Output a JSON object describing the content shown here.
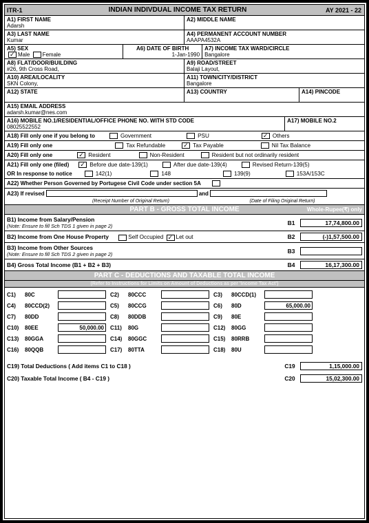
{
  "header": {
    "code": "ITR-1",
    "title": "INDIAN INDIVDUAL INCOME TAX RETURN",
    "ay": "AY 2021 - 22"
  },
  "a1": {
    "lbl": "A1) FIRST NAME",
    "val": "Adarsh"
  },
  "a2": {
    "lbl": "A2) MIDDLE NAME",
    "val": ""
  },
  "a3": {
    "lbl": "A3) LAST NAME",
    "val": "Kumar"
  },
  "a4": {
    "lbl": "A4) PERMANENT ACCOUNT NUMBER",
    "val": "AAAPA4532A"
  },
  "a5": {
    "lbl": "A5) SEX",
    "male": "Male",
    "female": "Female"
  },
  "a6": {
    "lbl": "A6) DATE OF BIRTH",
    "val": "1-Jan-1990"
  },
  "a7": {
    "lbl": "A7) INCOME TAX WARD/CIRCLE",
    "val": "Bangalore"
  },
  "a8": {
    "lbl": "A8) FLAT/DOOR/BUILDING",
    "val": "#26, 9th Cross Road,"
  },
  "a9": {
    "lbl": "A9) ROAD/STREET",
    "val": "Balaji Layout,"
  },
  "a10": {
    "lbl": "A10) AREA/LOCALITY",
    "val": "SKN Colony,"
  },
  "a11": {
    "lbl": "A11) TOWN/CITY/DISTRICT",
    "val": "Bangalore"
  },
  "a12": {
    "lbl": "A12) STATE"
  },
  "a13": {
    "lbl": "A13) COUNTRY"
  },
  "a14": {
    "lbl": "A14) PINCODE"
  },
  "a15": {
    "lbl": "A15) EMAIL ADDRESS",
    "val": "adarsh.kumar@nes.com"
  },
  "a16": {
    "lbl": "A16) MOBILE NO.1/RESIDENTIAL/OFFICE PHONE NO. WITH STD CODE",
    "val": "08025522552"
  },
  "a17": {
    "lbl": "A17) MOBILE NO.2"
  },
  "a18": {
    "lbl": "A18) Fill only one if you belong to",
    "o1": "Government",
    "o2": "PSU",
    "o3": "Others"
  },
  "a19": {
    "lbl": "A19) Fill only one",
    "o1": "Tax Refundable",
    "o2": "Tax Payable",
    "o3": "Nil Tax Balance"
  },
  "a20": {
    "lbl": "A20) Fill only one",
    "o1": "Resident",
    "o2": "Non-Resident",
    "o3": "Resident but not ordinarily resident"
  },
  "a21": {
    "lbl": "A21) Fill only one (filed)",
    "o1": "Before due date-139(1)",
    "o2": "After due date-139(4)",
    "o3": "Revised Return-139(5)"
  },
  "a21b": {
    "lbl": "OR In response to notice",
    "o1": "142(1)",
    "o2": "148",
    "o3": "139(9)",
    "o4": "153A/153C"
  },
  "a22": {
    "lbl": "A22) Whether Person Governed by Portugese Civil Code under section 5A"
  },
  "a23": {
    "lbl": "A23) If revised",
    "and": "and",
    "c1": "(Receipt Number of Original Return)",
    "c2": "(Date of Filing Original Return)"
  },
  "partB": {
    "title": "PART B - GROSS TOTAL INCOME",
    "side": "Whole-Rupee(₹) only"
  },
  "b1": {
    "t": "B1) Income from Salary/Pension",
    "n": "(Note: Ensure to fill Sch TDS 1 given in page 2)",
    "c": "B1",
    "v": "17,74,800.00"
  },
  "b2": {
    "t": "B2) Income from One House Property",
    "o1": "Self Occupied",
    "o2": "Let out",
    "c": "B2",
    "v": "(-)1,57,500.00"
  },
  "b3": {
    "t": "B3) Income from Other Sources",
    "n": "(Note: Ensure to fill Sch TDS 2 given in page 2)",
    "c": "B3",
    "v": ""
  },
  "b4": {
    "t": "B4) Gross Total Income (B1 + B2 + B3)",
    "c": "B4",
    "v": "16,17,300.00"
  },
  "partC": {
    "title": "PART C - DEDUCTIONS AND TAXABLE TOTAL INCOME",
    "sub": "(Refer to Instructions for Limits on Amount of Deductions as per 'Income Tax Act')"
  },
  "ded": [
    [
      {
        "c": "C1)",
        "n": "80C",
        "v": ""
      },
      {
        "c": "C2)",
        "n": "80CCC",
        "v": ""
      },
      {
        "c": "C3)",
        "n": "80CCD(1)",
        "v": ""
      }
    ],
    [
      {
        "c": "C4)",
        "n": "80CCD(2)",
        "v": ""
      },
      {
        "c": "C5)",
        "n": "80CCG",
        "v": ""
      },
      {
        "c": "C6)",
        "n": "80D",
        "v": "65,000.00"
      }
    ],
    [
      {
        "c": "C7)",
        "n": "80DD",
        "v": ""
      },
      {
        "c": "C8)",
        "n": "80DDB",
        "v": ""
      },
      {
        "c": "C9)",
        "n": "80E",
        "v": ""
      }
    ],
    [
      {
        "c": "C10)",
        "n": "80EE",
        "v": "50,000.00"
      },
      {
        "c": "C11)",
        "n": "80G",
        "v": ""
      },
      {
        "c": "C12)",
        "n": "80GG",
        "v": ""
      }
    ],
    [
      {
        "c": "C13)",
        "n": "80GGA",
        "v": ""
      },
      {
        "c": "C14)",
        "n": "80GGC",
        "v": ""
      },
      {
        "c": "C15)",
        "n": "80RRB",
        "v": ""
      }
    ],
    [
      {
        "c": "C16)",
        "n": "80QQB",
        "v": ""
      },
      {
        "c": "C17)",
        "n": "80TTA",
        "v": ""
      },
      {
        "c": "C18)",
        "n": "80U",
        "v": ""
      }
    ]
  ],
  "c19": {
    "t": "C19) Total Deductions ( Add items C1 to C18 )",
    "c": "C19",
    "v": "1,15,000.00"
  },
  "c20": {
    "t": "C20) Taxable Total Income ( B4 - C19 )",
    "c": "C20",
    "v": "15,02,300.00"
  }
}
